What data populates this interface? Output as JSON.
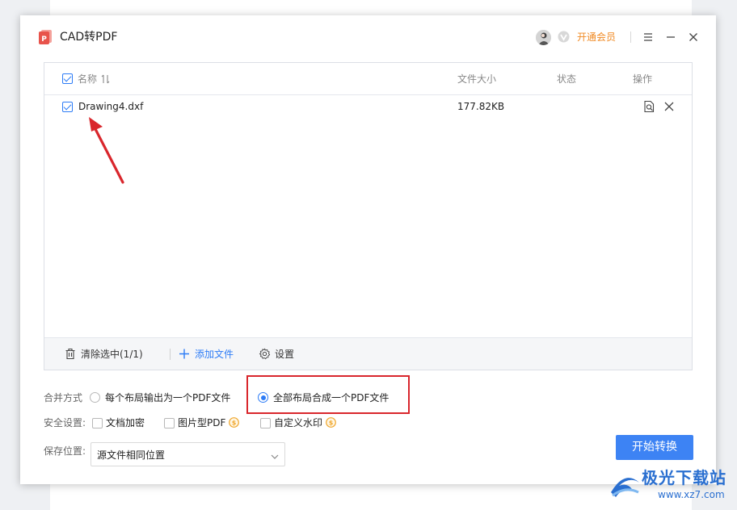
{
  "app": {
    "title": "CAD转PDF",
    "vip_link": "开通会员",
    "accent_color": "#3d83f4",
    "vip_color": "#f08a24",
    "logo_color": "#e8534b"
  },
  "window_controls": [
    "menu-icon",
    "minimize-icon",
    "close-icon"
  ],
  "file_list": {
    "columns": {
      "name": "名称",
      "size": "文件大小",
      "status": "状态",
      "action": "操作"
    },
    "rows": [
      {
        "name": "Drawing4.dxf",
        "size": "177.82KB",
        "status": "",
        "checked": true
      }
    ],
    "footer": {
      "clear": "清除选中(1/1)",
      "add": "添加文件",
      "settings": "设置"
    }
  },
  "options": {
    "merge_label": "合并方式",
    "merge_options": [
      {
        "label": "每个布局输出为一个PDF文件",
        "selected": false
      },
      {
        "label": "全部布局合成一个PDF文件",
        "selected": true
      }
    ],
    "security_label": "安全设置:",
    "security_options": [
      {
        "label": "文档加密",
        "checked": false,
        "vip": false
      },
      {
        "label": "图片型PDF",
        "checked": false,
        "vip": true
      },
      {
        "label": "自定义水印",
        "checked": false,
        "vip": true
      }
    ],
    "save_label": "保存位置:",
    "save_location": "源文件相同位置"
  },
  "start_button": "开始转换",
  "annotation_color": "#d9262c",
  "watermark": {
    "name": "极光下载站",
    "url": "www.xz7.com"
  }
}
